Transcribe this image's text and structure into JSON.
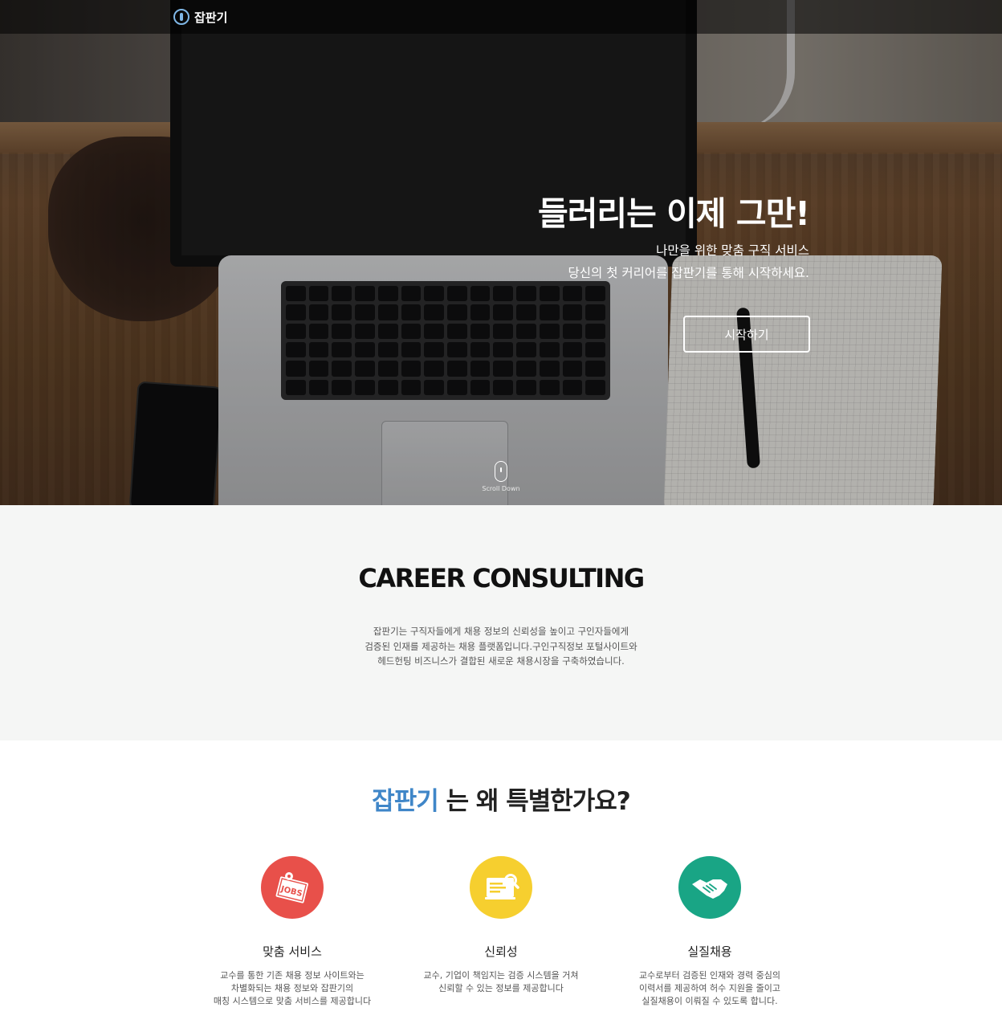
{
  "navbar": {
    "brand": "잡판기",
    "brand_icon": "tie-logo-icon"
  },
  "hero": {
    "title": "들러리는 이제 그만!",
    "subtitle_line1": "나만을 위한 맞춤 구직 서비스",
    "subtitle_line2": "당신의 첫 커리어를 잡판기를 통해 시작하세요.",
    "cta_label": "시작하기",
    "scroll_label": "Scroll Down",
    "scroll_icon": "mouse-icon"
  },
  "consulting": {
    "title": "CAREER CONSULTING",
    "desc_line1": "잡판기는 구직자들에게 채용 정보의 신뢰성을 높이고 구인자들에게",
    "desc_line2": "검증된 인재를 제공하는 채용 플랫폼입니다.구인구직정보 포털사이트와",
    "desc_line3": "헤드헌팅 비즈니스가 결합된 새로운 채용시장을 구축하였습니다."
  },
  "why": {
    "title_accent": "잡판기",
    "title_rest": " 는 왜 특별한가요?",
    "accent_color": "#3f86c8",
    "features": [
      {
        "icon": "jobs-note-icon",
        "color": "#e8504a",
        "name": "맞춤 서비스",
        "desc_line1": "교수를 통한 기존 채용 정보 사이트와는",
        "desc_line2": "차별화되는 채용 정보와 잡판기의",
        "desc_line3": "매칭 시스템으로 맞춤 서비스를 제공합니다"
      },
      {
        "icon": "document-search-icon",
        "color": "#f6cf2f",
        "name": "신뢰성",
        "desc_line1": "교수, 기업이 책임지는 검증 시스템을 거쳐",
        "desc_line2": "신뢰할 수 있는 정보를 제공합니다",
        "desc_line3": ""
      },
      {
        "icon": "handshake-icon",
        "color": "#19a585",
        "name": "실질채용",
        "desc_line1": "교수로부터 검증된 인재와 경력 중심의",
        "desc_line2": "이력서를 제공하여 허수 지원을 줄이고",
        "desc_line3": "실질채용이 이뤄질 수 있도록 합니다."
      }
    ]
  }
}
